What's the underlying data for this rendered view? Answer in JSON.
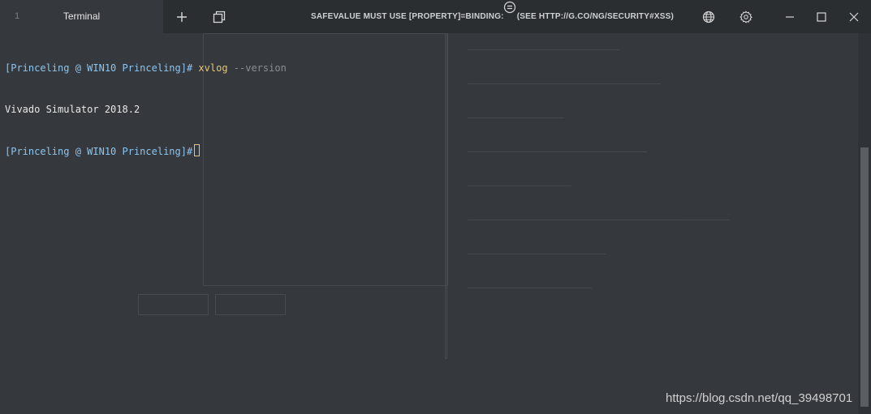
{
  "window": {
    "tab": {
      "index": "1",
      "title": "Terminal"
    },
    "banner": {
      "left": "SAFEVALUE MUST USE [PROPERTY]=BINDING:",
      "right": "(SEE HTTP://G.CO/NG/SECURITY#XSS)"
    },
    "icons": {
      "new_tab": "plus-icon",
      "tabs": "tabs-icon",
      "pin": "pin-icon",
      "globe": "globe-icon",
      "settings": "gear-icon",
      "minimize": "minimize-icon",
      "maximize": "maximize-icon",
      "close": "close-icon"
    }
  },
  "terminal": {
    "lines": [
      {
        "prompt": "[Princeling @ WIN10 Princeling]#",
        "command": "xvlog",
        "args": "--version"
      },
      {
        "output": "Vivado Simulator 2018.2"
      },
      {
        "prompt": "[Princeling @ WIN10 Princeling]#",
        "command": "",
        "args": ""
      }
    ]
  },
  "watermark": "https://blog.csdn.net/qq_39498701",
  "colors": {
    "background": "#35393d",
    "titlebar": "#2b2e31",
    "prompt": "#8cc5ef",
    "command": "#e2c77a",
    "argument": "#8b8f94"
  }
}
